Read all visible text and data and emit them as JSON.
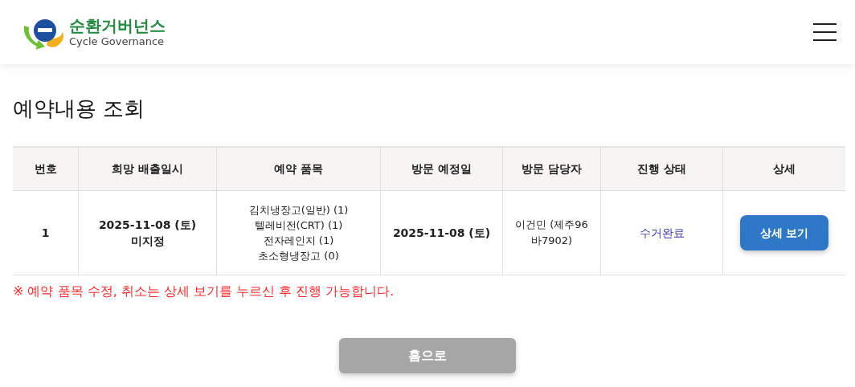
{
  "header": {
    "logo": {
      "title": "순환거버넌스",
      "subtitle": "Cycle Governance"
    }
  },
  "page_title": "예약내용 조회",
  "table": {
    "columns": [
      "번호",
      "희망 배출일시",
      "예약 품목",
      "방문 예정일",
      "방문 담당자",
      "진행 상태",
      "상세"
    ],
    "rows": [
      {
        "number": "1",
        "desired_date": [
          "2025-11-08 (토)",
          "미지정"
        ],
        "items": [
          "김치냉장고(일반) (1)",
          "텔레비전(CRT) (1)",
          "전자레인지 (1)",
          "초소형냉장고 (0)"
        ],
        "visit_date": "2025-11-08 (토)",
        "staff": "이건민 (제주96 바7902)",
        "status": "수거완료",
        "detail_button": "상세 보기"
      }
    ]
  },
  "notice": "※ 예약 품목 수정, 취소는 상세 보기를 누르신 후 진행 가능합니다.",
  "home_button": "홈으로"
}
